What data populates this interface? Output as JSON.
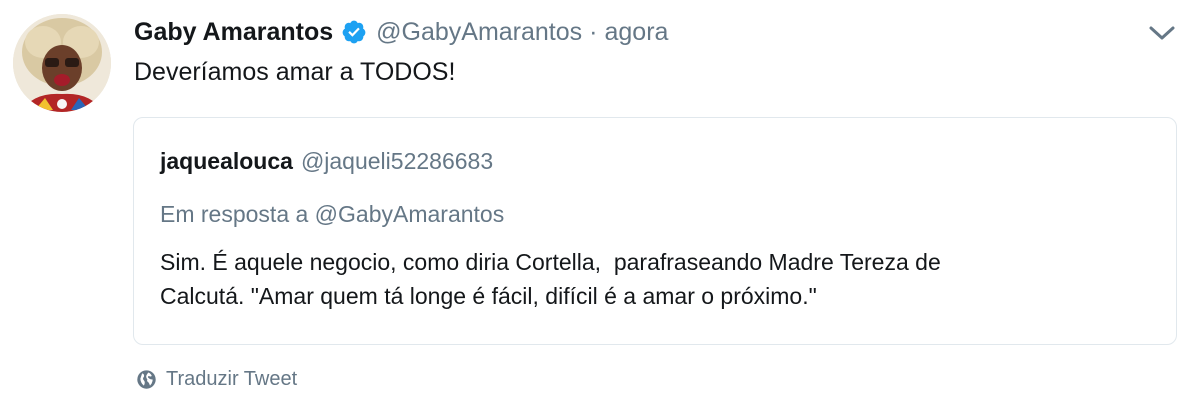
{
  "tweet": {
    "display_name": "Gaby Amarantos",
    "handle": "@GabyAmarantos",
    "separator": "·",
    "timestamp": "agora",
    "text": "Deveríamos amar a TODOS!",
    "verified_icon": "verified-badge-icon",
    "menu_icon": "chevron-down-icon"
  },
  "quoted_tweet": {
    "display_name": "jaquealouca",
    "handle": "@jaqueli52286683",
    "reply_to": "Em resposta a @GabyAmarantos",
    "text": "Sim. É aquele negocio, como diria Cortella,  parafraseando Madre Tereza de\nCalcutá. \"Amar quem tá longe é fácil, difícil é a amar o próximo.\""
  },
  "translate": {
    "label": "Traduzir Tweet",
    "icon": "globe-icon"
  },
  "colors": {
    "verified": "#1da1f2",
    "secondary_text": "#657786",
    "primary_text": "#14171a",
    "border": "#e1e8ed"
  }
}
